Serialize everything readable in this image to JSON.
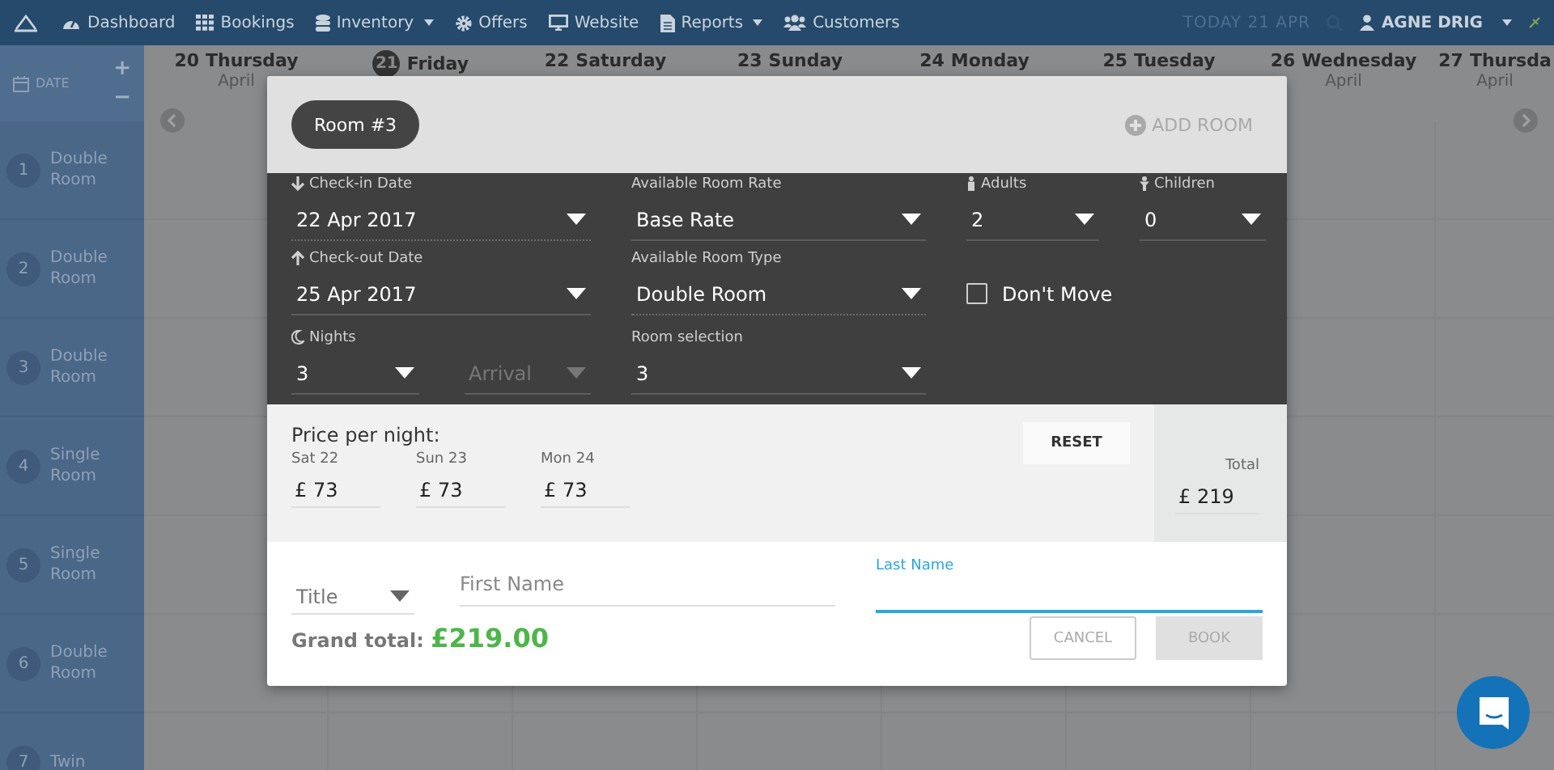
{
  "nav": {
    "items": [
      {
        "label": "Dashboard",
        "kind": "gauge",
        "dropdown": false
      },
      {
        "label": "Bookings",
        "kind": "grid",
        "dropdown": false
      },
      {
        "label": "Inventory",
        "kind": "database",
        "dropdown": true
      },
      {
        "label": "Offers",
        "kind": "gear",
        "dropdown": false
      },
      {
        "label": "Website",
        "kind": "monitor",
        "dropdown": false
      },
      {
        "label": "Reports",
        "kind": "document",
        "dropdown": true
      },
      {
        "label": "Customers",
        "kind": "people",
        "dropdown": false
      }
    ],
    "today": "TODAY 21 APR",
    "user": "AGNE DRIG"
  },
  "calendar": {
    "header": "DATE",
    "add": "+",
    "remove": "−",
    "days": [
      {
        "day": "20",
        "weekday": "Thursday",
        "month": "April",
        "selected": false
      },
      {
        "day": "21",
        "weekday": "Friday",
        "selected": true
      },
      {
        "day": "22",
        "weekday": "Saturday",
        "selected": false
      },
      {
        "day": "23",
        "weekday": "Sunday",
        "selected": false
      },
      {
        "day": "24",
        "weekday": "Monday",
        "selected": false
      },
      {
        "day": "25",
        "weekday": "Tuesday",
        "selected": false
      },
      {
        "day": "26",
        "weekday": "Wednesday",
        "month": "April",
        "selected": false
      },
      {
        "day": "27",
        "weekday": "Thursda",
        "month": "April",
        "selected": false
      }
    ],
    "rooms": [
      {
        "number": "1",
        "name": "Double Room"
      },
      {
        "number": "2",
        "name": "Double Room"
      },
      {
        "number": "3",
        "name": "Double Room"
      },
      {
        "number": "4",
        "name": "Single Room"
      },
      {
        "number": "5",
        "name": "Single Room"
      },
      {
        "number": "6",
        "name": "Double Room"
      },
      {
        "number": "7",
        "name": "Twin"
      }
    ]
  },
  "booking": {
    "room_tab": "Room #3",
    "add_room": "ADD ROOM",
    "check_in": {
      "label": "Check-in Date",
      "value": "22 Apr 2017"
    },
    "rate": {
      "label": "Available Room Rate",
      "value": "Base Rate"
    },
    "adults": {
      "label": "Adults",
      "value": "2"
    },
    "children": {
      "label": "Children",
      "value": "0"
    },
    "check_out": {
      "label": "Check-out Date",
      "value": "25 Apr 2017"
    },
    "room_type": {
      "label": "Available Room Type",
      "value": "Double Room"
    },
    "dont_move": {
      "label": "Don't Move",
      "checked": false
    },
    "nights": {
      "label": "Nights",
      "value": "3"
    },
    "arrival": {
      "placeholder": "Arrival",
      "disabled": true
    },
    "room_selection": {
      "label": "Room selection",
      "value": "3"
    },
    "price": {
      "heading": "Price per night:",
      "reset": "RESET",
      "nights": [
        {
          "day": "Sat 22",
          "value": "£ 73"
        },
        {
          "day": "Sun 23",
          "value": "£ 73"
        },
        {
          "day": "Mon 24",
          "value": "£ 73"
        }
      ],
      "total_label": "Total",
      "total": "£ 219"
    },
    "guest": {
      "title_placeholder": "Title",
      "first_name_placeholder": "First Name",
      "last_name_label": "Last Name",
      "grand_total_label": "Grand total:",
      "grand_total": "£219.00",
      "cancel": "CANCEL",
      "book": {
        "label": "BOOK",
        "disabled": true
      }
    }
  }
}
